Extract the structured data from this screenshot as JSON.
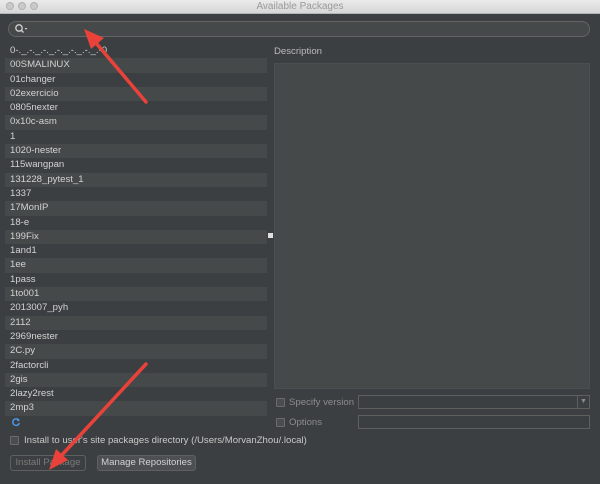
{
  "window": {
    "title": "Available Packages"
  },
  "search": {
    "value": ""
  },
  "packages": [
    "0-._.-._.-._.-._.-._.-._.-0",
    "00SMALINUX",
    "01changer",
    "02exercicio",
    "0805nexter",
    "0x10c-asm",
    "1",
    "1020-nester",
    "115wangpan",
    "131228_pytest_1",
    "1337",
    "17MonIP",
    "18-e",
    "199Fix",
    "1and1",
    "1ee",
    "1pass",
    "1to001",
    "2013007_pyh",
    "2112",
    "2969nester",
    "2C.py",
    "2factorcli",
    "2gis",
    "2lazy2rest",
    "2mp3"
  ],
  "description": {
    "label": "Description",
    "text": ""
  },
  "specify_version": {
    "label": "Specify version",
    "checked": false,
    "value": ""
  },
  "options": {
    "label": "Options",
    "checked": false,
    "value": ""
  },
  "user_site": {
    "label": "Install to user's site packages directory (/Users/MorvanZhou/.local)",
    "checked": false
  },
  "buttons": {
    "install": "Install Package",
    "manage": "Manage Repositories"
  },
  "colors": {
    "background": "#3c3f41",
    "list_alt": "#45494a",
    "annotation_arrow": "#e8423a"
  }
}
